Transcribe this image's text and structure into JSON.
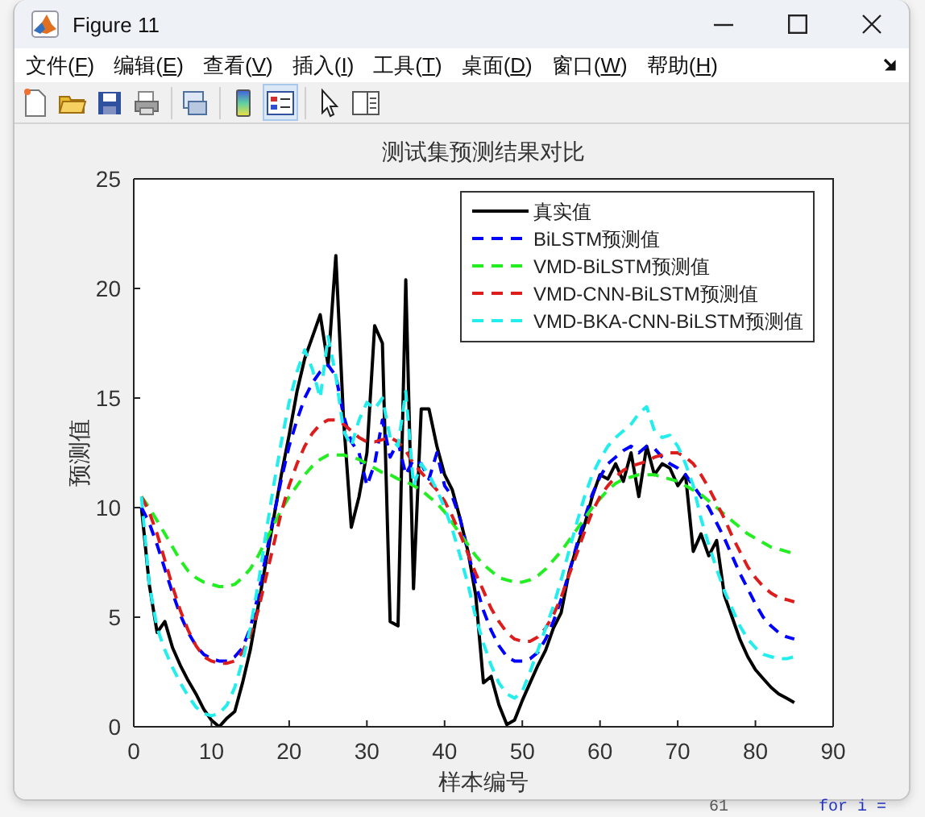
{
  "window": {
    "title": "Figure 11"
  },
  "menu": [
    {
      "label": "文件(F)"
    },
    {
      "label": "编辑(E)"
    },
    {
      "label": "查看(V)"
    },
    {
      "label": "插入(I)"
    },
    {
      "label": "工具(T)"
    },
    {
      "label": "桌面(D)"
    },
    {
      "label": "窗口(W)"
    },
    {
      "label": "帮助(H)"
    }
  ],
  "toolbar": [
    {
      "pressed": false
    },
    {
      "pressed": false
    },
    {
      "pressed": false
    },
    {
      "pressed": false
    },
    {
      "pressed": false
    },
    {
      "pressed": false
    },
    {
      "pressed": true
    },
    {
      "pressed": false
    },
    {
      "pressed": false
    }
  ],
  "figure": {
    "chart_data": {
      "type": "line",
      "title": "测试集预测结果对比",
      "xlabel": "样本编号",
      "ylabel": "预测值",
      "x": [
        1,
        2,
        3,
        4,
        5,
        6,
        7,
        8,
        9,
        10,
        11,
        12,
        13,
        14,
        15,
        16,
        17,
        18,
        19,
        20,
        21,
        22,
        23,
        24,
        25,
        26,
        27,
        28,
        29,
        30,
        31,
        32,
        33,
        34,
        35,
        36,
        37,
        38,
        39,
        40,
        41,
        42,
        43,
        44,
        45,
        46,
        47,
        48,
        49,
        50,
        51,
        52,
        53,
        54,
        55,
        56,
        57,
        58,
        59,
        60,
        61,
        62,
        63,
        64,
        65,
        66,
        67,
        68,
        69,
        70,
        71,
        72,
        73,
        74,
        75,
        76,
        77,
        78,
        79,
        80,
        81,
        82,
        83,
        84,
        85
      ],
      "series": [
        {
          "name": "真实值",
          "color": "#000000",
          "line_style": "solid",
          "values": [
            10,
            6.5,
            4.3,
            4.8,
            3.6,
            2.8,
            2.1,
            1.5,
            0.8,
            0.3,
            0,
            0.4,
            0.7,
            2,
            3.5,
            5.5,
            7.5,
            9.5,
            11.5,
            13.3,
            15.3,
            16.8,
            17.8,
            18.8,
            16.5,
            21.5,
            14,
            9.1,
            10.5,
            12.5,
            18.3,
            17.5,
            4.8,
            4.6,
            20.4,
            6.3,
            14.5,
            14.5,
            12.8,
            11.5,
            10.8,
            9.5,
            8,
            6,
            2,
            2.3,
            1,
            0.1,
            0.3,
            1.2,
            2,
            2.8,
            3.5,
            4.5,
            5.2,
            7,
            8.2,
            9.2,
            10.5,
            11.5,
            11.3,
            12,
            11.2,
            12.5,
            10.5,
            12.8,
            11.5,
            12,
            11.8,
            11,
            11.5,
            8,
            8.8,
            7.8,
            8.5,
            6,
            5,
            4,
            3.2,
            2.6,
            2.2,
            1.8,
            1.5,
            1.3,
            1.1
          ]
        },
        {
          "name": "BiLSTM预测值",
          "color": "#0000ff",
          "line_style": "dashed",
          "values": [
            10,
            9.3,
            8.3,
            7.2,
            6.1,
            5.1,
            4.3,
            3.7,
            3.3,
            3.1,
            3,
            3,
            3.2,
            3.6,
            4.5,
            6,
            7.8,
            9.6,
            11.3,
            12.8,
            14,
            15,
            15.7,
            16.2,
            16.5,
            16,
            14.2,
            13,
            12.5,
            11,
            12,
            14,
            12.3,
            13,
            11.5,
            12.2,
            12,
            11.3,
            12.5,
            11,
            10.5,
            9.5,
            8,
            6.5,
            5.3,
            4.4,
            3.7,
            3.2,
            3,
            3,
            3.1,
            3.4,
            4,
            4.8,
            5.8,
            7,
            8.3,
            9.5,
            10.6,
            11.4,
            12,
            12.3,
            12.6,
            12.8,
            12.5,
            12.8,
            12.7,
            12.3,
            12,
            11.8,
            11.5,
            11,
            10.5,
            10,
            9.3,
            8.6,
            7.8,
            7,
            6.3,
            5.6,
            5,
            4.6,
            4.3,
            4.1,
            4
          ]
        },
        {
          "name": "VMD-BiLSTM预测值",
          "color": "#22ee22",
          "line_style": "dashed",
          "values": [
            10.5,
            10,
            9.4,
            8.8,
            8.2,
            7.6,
            7.1,
            6.8,
            6.6,
            6.5,
            6.4,
            6.4,
            6.5,
            6.8,
            7.2,
            7.8,
            8.5,
            9.2,
            9.9,
            10.5,
            11,
            11.5,
            11.9,
            12.2,
            12.4,
            12.4,
            12.4,
            12.3,
            12.2,
            12,
            11.8,
            11.6,
            11.5,
            11.3,
            11.2,
            11,
            10.8,
            10.5,
            10.2,
            9.8,
            9.3,
            8.8,
            8.3,
            7.8,
            7.4,
            7.1,
            6.8,
            6.7,
            6.6,
            6.6,
            6.7,
            6.9,
            7.2,
            7.6,
            8,
            8.5,
            9,
            9.5,
            10,
            10.4,
            10.8,
            11.1,
            11.3,
            11.4,
            11.5,
            11.5,
            11.5,
            11.4,
            11.3,
            11.2,
            11,
            10.8,
            10.6,
            10.3,
            10,
            9.7,
            9.4,
            9.1,
            8.8,
            8.6,
            8.4,
            8.2,
            8.1,
            8,
            7.9
          ]
        },
        {
          "name": "VMD-CNN-BiLSTM预测值",
          "color": "#dd1c1c",
          "line_style": "dashed",
          "values": [
            10.5,
            9.8,
            8.8,
            7.6,
            6.4,
            5.3,
            4.4,
            3.7,
            3.2,
            3,
            2.9,
            2.9,
            3,
            3.4,
            4.2,
            5.3,
            6.8,
            8.3,
            9.8,
            11,
            12,
            12.8,
            13.4,
            13.8,
            14,
            14,
            13.8,
            13.5,
            13.2,
            13,
            13,
            13.1,
            13.2,
            13,
            12.6,
            12,
            11.6,
            11.2,
            10.8,
            10.3,
            9.6,
            8.8,
            7.9,
            7,
            6.2,
            5.4,
            4.8,
            4.3,
            4,
            3.9,
            3.9,
            4.1,
            4.5,
            5.1,
            5.9,
            6.9,
            7.9,
            8.9,
            9.8,
            10.5,
            11,
            11.4,
            11.7,
            11.9,
            12,
            12.1,
            12.3,
            12.4,
            12.5,
            12.5,
            12.3,
            12,
            11.5,
            10.9,
            10.2,
            9.5,
            8.7,
            8,
            7.3,
            6.8,
            6.4,
            6.1,
            5.9,
            5.8,
            5.7
          ]
        },
        {
          "name": "VMD-BKA-CNN-BiLSTM预测值",
          "color": "#22eeee",
          "line_style": "dashed",
          "values": [
            10.5,
            6.5,
            4.5,
            3.5,
            2.7,
            2,
            1.4,
            0.9,
            0.6,
            0.5,
            0.6,
            1,
            1.8,
            3,
            4.5,
            6.5,
            8.8,
            11,
            13,
            14.8,
            16.2,
            17.2,
            16.3,
            15,
            17.8,
            16,
            13.5,
            12.8,
            14,
            14.8,
            14.5,
            15,
            13.2,
            12.8,
            15.3,
            11,
            12,
            11.5,
            10.8,
            10,
            9,
            7.8,
            6.5,
            5,
            3.8,
            2.8,
            2,
            1.5,
            1.3,
            1.6,
            2.5,
            3.5,
            4.5,
            5.5,
            6.7,
            8,
            9.3,
            10.5,
            11.5,
            12.2,
            12.8,
            13.2,
            13.5,
            13.8,
            14.3,
            14.6,
            13.5,
            13.2,
            13.3,
            12.8,
            12,
            11,
            9.5,
            8.3,
            7.2,
            6.2,
            5.4,
            4.6,
            4,
            3.6,
            3.3,
            3.2,
            3.1,
            3.1,
            3.2
          ]
        }
      ],
      "legend": true,
      "xlim": [
        0,
        90
      ],
      "ylim": [
        0,
        25
      ],
      "xticks": [
        0,
        10,
        20,
        30,
        40,
        50,
        60,
        70,
        80,
        90
      ],
      "yticks": [
        0,
        5,
        10,
        15,
        20,
        25
      ]
    }
  },
  "background": {
    "line_number": "61",
    "code": "for i ="
  }
}
